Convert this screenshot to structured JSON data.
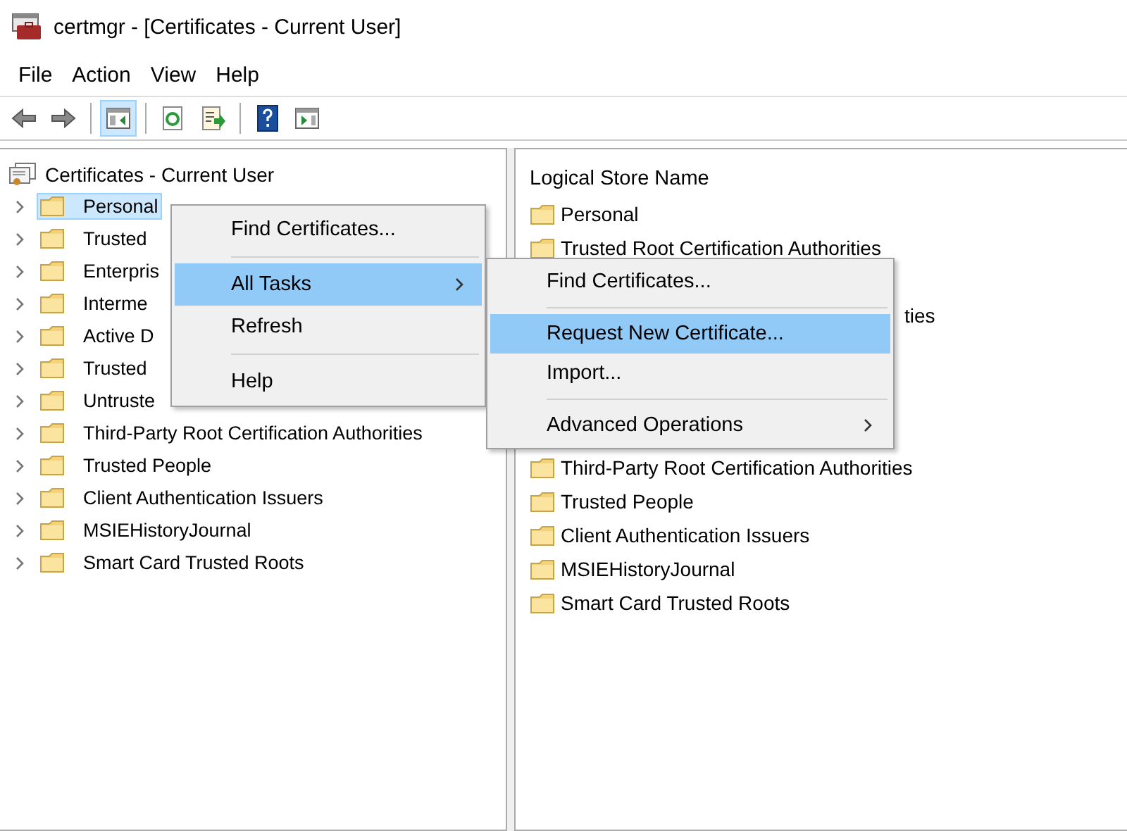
{
  "window": {
    "title": "certmgr - [Certificates - Current User]"
  },
  "menu_bar": [
    "File",
    "Action",
    "View",
    "Help"
  ],
  "toolbar": {
    "buttons": [
      {
        "pressed": false
      },
      {
        "pressed": false
      },
      {
        "pressed": true
      },
      {
        "pressed": false
      },
      {
        "pressed": false
      },
      {
        "pressed": false
      },
      {
        "pressed": false
      }
    ]
  },
  "tree": {
    "root": "Certificates - Current User",
    "items": [
      {
        "label": "Personal",
        "selected": true,
        "expanded": false
      },
      {
        "label": "Trusted",
        "selected": false,
        "expanded": false
      },
      {
        "label": "Enterpris",
        "selected": false,
        "expanded": false
      },
      {
        "label": "Interme",
        "selected": false,
        "expanded": false
      },
      {
        "label": "Active D",
        "selected": false,
        "expanded": false
      },
      {
        "label": "Trusted",
        "selected": false,
        "expanded": false
      },
      {
        "label": "Untruste",
        "selected": false,
        "expanded": false
      },
      {
        "label": "Third-Party Root Certification Authorities",
        "selected": false,
        "expanded": false
      },
      {
        "label": "Trusted People",
        "selected": false,
        "expanded": false
      },
      {
        "label": "Client Authentication Issuers",
        "selected": false,
        "expanded": false
      },
      {
        "label": "MSIEHistoryJournal",
        "selected": false,
        "expanded": false
      },
      {
        "label": "Smart Card Trusted Roots",
        "selected": false,
        "expanded": false
      }
    ]
  },
  "list": {
    "column_header": "Logical Store Name",
    "items_above": [
      "Personal",
      "Trusted Root Certification Authorities"
    ],
    "fragment": "ties",
    "items_below": [
      "Third-Party Root Certification Authorities",
      "Trusted People",
      "Client Authentication Issuers",
      "MSIEHistoryJournal",
      "Smart Card Trusted Roots"
    ]
  },
  "context_menu": {
    "items": [
      {
        "kind": "item",
        "label": "Find Certificates...",
        "selected": false,
        "submenu": false
      },
      {
        "kind": "separator"
      },
      {
        "kind": "item",
        "label": "All Tasks",
        "selected": true,
        "submenu": true
      },
      {
        "kind": "item",
        "label": "Refresh",
        "selected": false,
        "submenu": false
      },
      {
        "kind": "separator"
      },
      {
        "kind": "item",
        "label": "Help",
        "selected": false,
        "submenu": false
      }
    ]
  },
  "submenu": {
    "items": [
      {
        "kind": "item",
        "label": "Find Certificates...",
        "selected": false,
        "submenu": false
      },
      {
        "kind": "separator"
      },
      {
        "kind": "item",
        "label": "Request New Certificate...",
        "selected": true,
        "submenu": false
      },
      {
        "kind": "item",
        "label": "Import...",
        "selected": false,
        "submenu": false
      },
      {
        "kind": "separator"
      },
      {
        "kind": "item",
        "label": "Advanced Operations",
        "selected": false,
        "submenu": true
      }
    ]
  }
}
